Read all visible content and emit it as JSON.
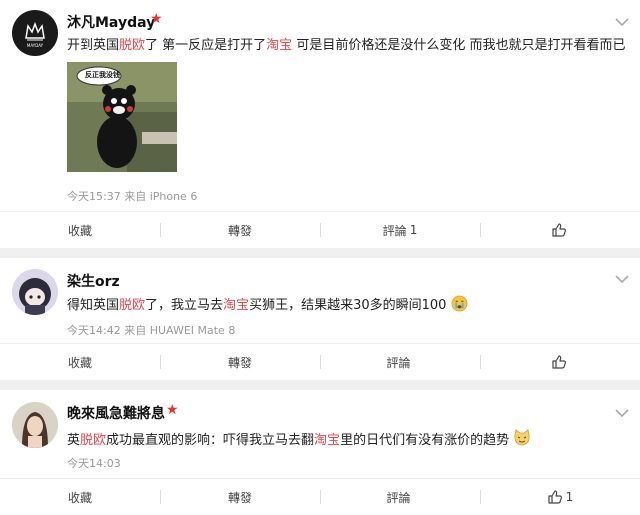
{
  "posts": [
    {
      "username": "沐凡Mayday",
      "vip_badge": "★",
      "content": {
        "before": "开到英国",
        "kw1": "脱欧",
        "mid1": "了 第一反应是打开了",
        "kw2": "淘宝",
        "after": " 可是目前价格还是没什么变化 而我也就只是打开看看而已"
      },
      "image_caption": "反正我没钱",
      "meta": "今天15:37 来自 iPhone 6",
      "actions": {
        "collect": "收藏",
        "repost": "轉發",
        "comment": "評論",
        "comment_count": "1",
        "like_count": ""
      }
    },
    {
      "username": "染生orz",
      "content": {
        "before": "得知英国",
        "kw1": "脱欧",
        "mid1": "了，我立马去",
        "kw2": "淘宝",
        "after": "买狮王，结果越来30多的瞬间100"
      },
      "emoji": "crying-face",
      "meta": "今天14:42 来自 HUAWEI Mate 8",
      "actions": {
        "collect": "收藏",
        "repost": "轉發",
        "comment": "評論",
        "comment_count": "",
        "like_count": ""
      }
    },
    {
      "username": "晚來風急難將息",
      "vip_badge": "★",
      "content": {
        "before": "英",
        "kw1": "脱欧",
        "mid1": "成功最直观的影响：吓得我立马去翻",
        "kw2": "淘宝",
        "after": "里的日代们有没有涨价的趋势"
      },
      "emoji": "cat-face",
      "meta": "今天14:03",
      "actions": {
        "collect": "收藏",
        "repost": "轉發",
        "comment": "評論",
        "comment_count": "",
        "like_count": "1"
      }
    }
  ],
  "colors": {
    "keyword": "#e0474c",
    "vip": "#e8352c",
    "meta": "#999999"
  }
}
